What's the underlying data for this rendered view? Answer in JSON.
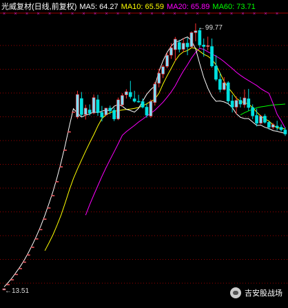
{
  "legend": {
    "title": "光威复材(日线,前复权)",
    "ma5": "MA5: 64.27",
    "ma10": "MA10: 65.59",
    "ma20": "MA20: 65.89",
    "ma60": "MA60: 73.71"
  },
  "colors": {
    "background": "#000000",
    "up": "#ff3232",
    "up_fill": "#7fdfff",
    "down": "#00e0e0",
    "ma5": "#ffffff",
    "ma10": "#ffff00",
    "ma20": "#ff00ff",
    "ma60": "#00ff00",
    "grid": "#a00000",
    "title": "#ffffff"
  },
  "watermark": "吉安股战场",
  "chart_data": {
    "type": "candlestick",
    "ylim": [
      12,
      102
    ],
    "annotations": [
      {
        "text": "99.77",
        "kind": "high"
      },
      {
        "text": "13.51",
        "kind": "low"
      }
    ],
    "ma5": [
      14.6,
      16,
      17.6,
      19.4,
      21.3,
      23.4,
      25.8,
      28.4,
      31.2,
      34.3,
      37.7,
      41.5,
      45.5,
      50,
      55,
      60.5,
      66.5,
      72.2,
      70.8,
      69.5,
      70.1,
      70.5,
      71.2,
      70.9,
      71.4,
      71.8,
      71.5,
      73,
      73.6,
      73,
      72,
      71.6,
      71.1,
      72.3,
      74.6,
      76.9,
      78.4,
      79.6,
      84.3,
      87.7,
      90.4,
      92.4,
      93.8,
      94.1,
      94.9,
      95.4,
      94.2,
      91.6,
      86.8,
      82.3,
      78.8,
      76.2,
      74.6,
      74.7,
      74.4,
      73.8,
      72.6,
      70.6,
      69.4,
      69,
      69,
      67.9,
      66.8,
      66.9,
      66.2,
      65.8,
      65.1,
      64.9,
      64.5,
      64.27
    ],
    "ma10": [
      null,
      null,
      null,
      null,
      null,
      null,
      null,
      null,
      null,
      null,
      26.3,
      28.8,
      31.5,
      34.6,
      37.9,
      41.8,
      45.9,
      49.6,
      52.7,
      55.6,
      58.5,
      61.2,
      63.8,
      66.6,
      69,
      70.2,
      70.9,
      71.4,
      71.6,
      71.8,
      72,
      72.1,
      72.3,
      72.6,
      73.1,
      73.8,
      74.6,
      75.3,
      77.2,
      80.2,
      82.8,
      85.2,
      87.7,
      89.6,
      90.6,
      91,
      91.9,
      91.7,
      90.8,
      89.8,
      89.2,
      88.1,
      86.4,
      83.7,
      81,
      79,
      77.4,
      75.6,
      74.6,
      74.1,
      73.7,
      72.6,
      71.1,
      69.8,
      68.9,
      68.2,
      67,
      65.9,
      66,
      65.59
    ],
    "ma20": [
      null,
      null,
      null,
      null,
      null,
      null,
      null,
      null,
      null,
      null,
      null,
      null,
      null,
      null,
      null,
      null,
      null,
      null,
      null,
      null,
      37.8,
      41.2,
      44.3,
      47.3,
      50.3,
      53.1,
      55.7,
      58.3,
      60.9,
      63.6,
      64.8,
      65.8,
      66.8,
      67.9,
      68.8,
      69.8,
      70.7,
      71.7,
      73,
      74.3,
      75.9,
      77.6,
      79.6,
      82.1,
      84.4,
      86.4,
      88.6,
      90.4,
      91.7,
      91.4,
      90.6,
      89.9,
      89.2,
      88.4,
      87.4,
      86.3,
      85.2,
      84,
      83,
      82.1,
      81.3,
      80.5,
      79.7,
      78.7,
      77.9,
      77.2,
      73.9,
      70.4,
      68.3,
      65.89
    ],
    "ma60": [
      null,
      null,
      null,
      null,
      null,
      null,
      null,
      null,
      null,
      null,
      null,
      null,
      null,
      null,
      null,
      null,
      null,
      null,
      null,
      null,
      null,
      null,
      null,
      null,
      null,
      null,
      null,
      null,
      null,
      null,
      null,
      null,
      null,
      null,
      null,
      null,
      null,
      null,
      null,
      null,
      null,
      null,
      null,
      null,
      null,
      null,
      null,
      null,
      null,
      null,
      null,
      null,
      null,
      null,
      null,
      null,
      null,
      null,
      70.2,
      70.9,
      71.5,
      72,
      72.5,
      72.8,
      73,
      73.2,
      73.4,
      73.5,
      73.6,
      73.71
    ],
    "candles": [
      {
        "o": 13.6,
        "h": 14.1,
        "l": 13.51,
        "c": 14
      },
      {
        "o": 15.4,
        "h": 15.5,
        "l": 15.3,
        "c": 15.4
      },
      {
        "o": 17,
        "h": 17.1,
        "l": 16.9,
        "c": 17
      },
      {
        "o": 18.7,
        "h": 18.8,
        "l": 18.6,
        "c": 18.7
      },
      {
        "o": 20.6,
        "h": 20.7,
        "l": 20.5,
        "c": 20.6
      },
      {
        "o": 22.7,
        "h": 22.8,
        "l": 22.6,
        "c": 22.7
      },
      {
        "o": 25,
        "h": 25.1,
        "l": 24.9,
        "c": 25
      },
      {
        "o": 27.5,
        "h": 27.6,
        "l": 27.4,
        "c": 27.5
      },
      {
        "o": 30.2,
        "h": 30.3,
        "l": 30.1,
        "c": 30.2
      },
      {
        "o": 33.2,
        "h": 33.3,
        "l": 33.1,
        "c": 33.2
      },
      {
        "o": 36.6,
        "h": 36.7,
        "l": 36.5,
        "c": 36.6
      },
      {
        "o": 40.2,
        "h": 40.3,
        "l": 40.1,
        "c": 40.2
      },
      {
        "o": 44.2,
        "h": 44.3,
        "l": 44.1,
        "c": 44.2
      },
      {
        "o": 48.7,
        "h": 48.8,
        "l": 48.6,
        "c": 48.7
      },
      {
        "o": 53.5,
        "h": 53.6,
        "l": 53.4,
        "c": 53.5
      },
      {
        "o": 58.9,
        "h": 59,
        "l": 58.8,
        "c": 58.9
      },
      {
        "o": 64.8,
        "h": 64.9,
        "l": 64.7,
        "c": 64.8
      },
      {
        "o": 71.2,
        "h": 71.3,
        "l": 71.1,
        "c": 71.2
      },
      {
        "o": 69.5,
        "h": 78,
        "l": 68.9,
        "c": 76.8
      },
      {
        "o": 75.5,
        "h": 77.6,
        "l": 69.6,
        "c": 70.3
      },
      {
        "o": 70.3,
        "h": 73.5,
        "l": 68.7,
        "c": 72.4
      },
      {
        "o": 71.8,
        "h": 73.6,
        "l": 70,
        "c": 70.8
      },
      {
        "o": 70.8,
        "h": 76.8,
        "l": 70.4,
        "c": 75.8
      },
      {
        "o": 75.1,
        "h": 76.7,
        "l": 69.9,
        "c": 71
      },
      {
        "o": 71,
        "h": 73.1,
        "l": 68.1,
        "c": 69.5
      },
      {
        "o": 70.2,
        "h": 72.5,
        "l": 69.8,
        "c": 72.4
      },
      {
        "o": 72.4,
        "h": 73.2,
        "l": 70.4,
        "c": 71.5
      },
      {
        "o": 71.7,
        "h": 72.6,
        "l": 68.2,
        "c": 68.9
      },
      {
        "o": 68.9,
        "h": 75.8,
        "l": 68.5,
        "c": 75.1
      },
      {
        "o": 73.4,
        "h": 77.2,
        "l": 72.9,
        "c": 76.5
      },
      {
        "o": 76.7,
        "h": 78.5,
        "l": 75.5,
        "c": 77.7
      },
      {
        "o": 77.5,
        "h": 81.2,
        "l": 75.4,
        "c": 76.1
      },
      {
        "o": 75.4,
        "h": 78,
        "l": 74.2,
        "c": 74.6
      },
      {
        "o": 74.6,
        "h": 76.7,
        "l": 74.1,
        "c": 74.5
      },
      {
        "o": 74.5,
        "h": 75.5,
        "l": 72.3,
        "c": 72.7
      },
      {
        "o": 72.7,
        "h": 73.8,
        "l": 69.3,
        "c": 70.1
      },
      {
        "o": 69.8,
        "h": 75.2,
        "l": 69.2,
        "c": 74.6
      },
      {
        "o": 74.2,
        "h": 80.9,
        "l": 73.2,
        "c": 80.2
      },
      {
        "o": 80.4,
        "h": 85.1,
        "l": 79.1,
        "c": 83.7
      },
      {
        "o": 83.4,
        "h": 86.4,
        "l": 82.1,
        "c": 85.8
      },
      {
        "o": 85.9,
        "h": 90.3,
        "l": 85.3,
        "c": 89.5
      },
      {
        "o": 89.5,
        "h": 93.4,
        "l": 88.3,
        "c": 91.9
      },
      {
        "o": 91.3,
        "h": 95.4,
        "l": 87.6,
        "c": 94.7
      },
      {
        "o": 93.6,
        "h": 94.5,
        "l": 90.4,
        "c": 91.4
      },
      {
        "o": 91.4,
        "h": 95,
        "l": 90.5,
        "c": 93.4
      },
      {
        "o": 93.4,
        "h": 95.1,
        "l": 89.5,
        "c": 92.2
      },
      {
        "o": 92.2,
        "h": 97.2,
        "l": 91.8,
        "c": 96.8
      },
      {
        "o": 96.8,
        "h": 99.77,
        "l": 94,
        "c": 97.4
      },
      {
        "o": 97.5,
        "h": 98.3,
        "l": 91.9,
        "c": 92.8
      },
      {
        "o": 92.8,
        "h": 94.9,
        "l": 89,
        "c": 92.3
      },
      {
        "o": 92.3,
        "h": 95.5,
        "l": 91.1,
        "c": 92.6
      },
      {
        "o": 92.3,
        "h": 94.9,
        "l": 85.5,
        "c": 86
      },
      {
        "o": 86,
        "h": 89.5,
        "l": 81.1,
        "c": 81.7
      },
      {
        "o": 81.7,
        "h": 83.8,
        "l": 77.5,
        "c": 78.4
      },
      {
        "o": 78.4,
        "h": 82.4,
        "l": 78.1,
        "c": 80.6
      },
      {
        "o": 80.6,
        "h": 81.1,
        "l": 73.9,
        "c": 74.7
      },
      {
        "o": 74.7,
        "h": 76.7,
        "l": 71,
        "c": 72.7
      },
      {
        "o": 72.7,
        "h": 76.2,
        "l": 70.4,
        "c": 74.9
      },
      {
        "o": 74.9,
        "h": 76,
        "l": 72.6,
        "c": 73.7
      },
      {
        "o": 73.5,
        "h": 78.4,
        "l": 72.5,
        "c": 75.7
      },
      {
        "o": 75.4,
        "h": 78.6,
        "l": 71.6,
        "c": 72.6
      },
      {
        "o": 72.6,
        "h": 73.6,
        "l": 68.8,
        "c": 69.9
      },
      {
        "o": 70,
        "h": 72.2,
        "l": 66.5,
        "c": 67.5
      },
      {
        "o": 67.5,
        "h": 70.2,
        "l": 67.2,
        "c": 69.8
      },
      {
        "o": 69.8,
        "h": 70.5,
        "l": 67.4,
        "c": 67.8
      },
      {
        "o": 67.8,
        "h": 68.2,
        "l": 65.4,
        "c": 66.2
      },
      {
        "o": 66.2,
        "h": 67.6,
        "l": 65.5,
        "c": 67.1
      },
      {
        "o": 66.6,
        "h": 68.3,
        "l": 65.2,
        "c": 66.1
      },
      {
        "o": 66.2,
        "h": 67.1,
        "l": 64.8,
        "c": 65.4
      },
      {
        "o": 65.3,
        "h": 66.2,
        "l": 63.4,
        "c": 64
      }
    ]
  }
}
